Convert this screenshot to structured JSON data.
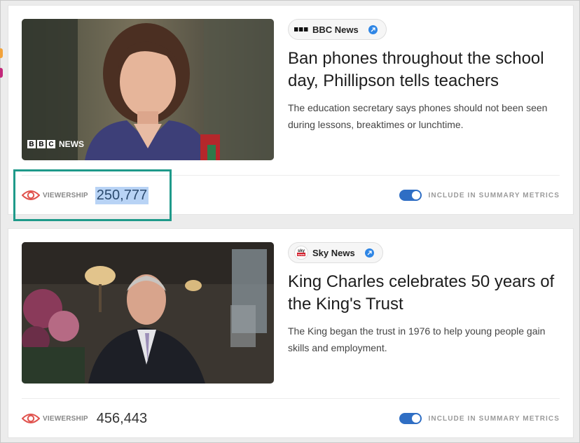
{
  "articles": [
    {
      "source": "BBC News",
      "headline": "Ban phones throughout the school day, Phillipson tells teachers",
      "summary": "The education secretary says phones should not been seen during lessons, breaktimes or lunchtime.",
      "watermark_letters": [
        "B",
        "B",
        "C"
      ],
      "watermark_word": "NEWS",
      "viewership_label": "VIEWERSHIP",
      "viewership": "250,777",
      "viewership_selected": true,
      "toggle_on": true,
      "toggle_label": "INCLUDE IN SUMMARY METRICS"
    },
    {
      "source": "Sky News",
      "headline": "King Charles celebrates 50 years of the King's Trust",
      "summary": "The King began the trust in 1976 to help young people gain skills and employment.",
      "logo_text": "sky news",
      "viewership_label": "VIEWERSHIP",
      "viewership": "456,443",
      "viewership_selected": false,
      "toggle_on": true,
      "toggle_label": "INCLUDE IN SUMMARY METRICS"
    }
  ],
  "colors": {
    "highlight_box": "#1f9a8a",
    "eye_icon": "#e0524d",
    "toggle": "#2f6ec4",
    "link_icon": "#2f86e5",
    "selection": "#b8d3f5"
  },
  "icons": [
    "eye-icon",
    "external-link-icon",
    "bbc-logo-icon",
    "sky-news-logo-icon"
  ]
}
